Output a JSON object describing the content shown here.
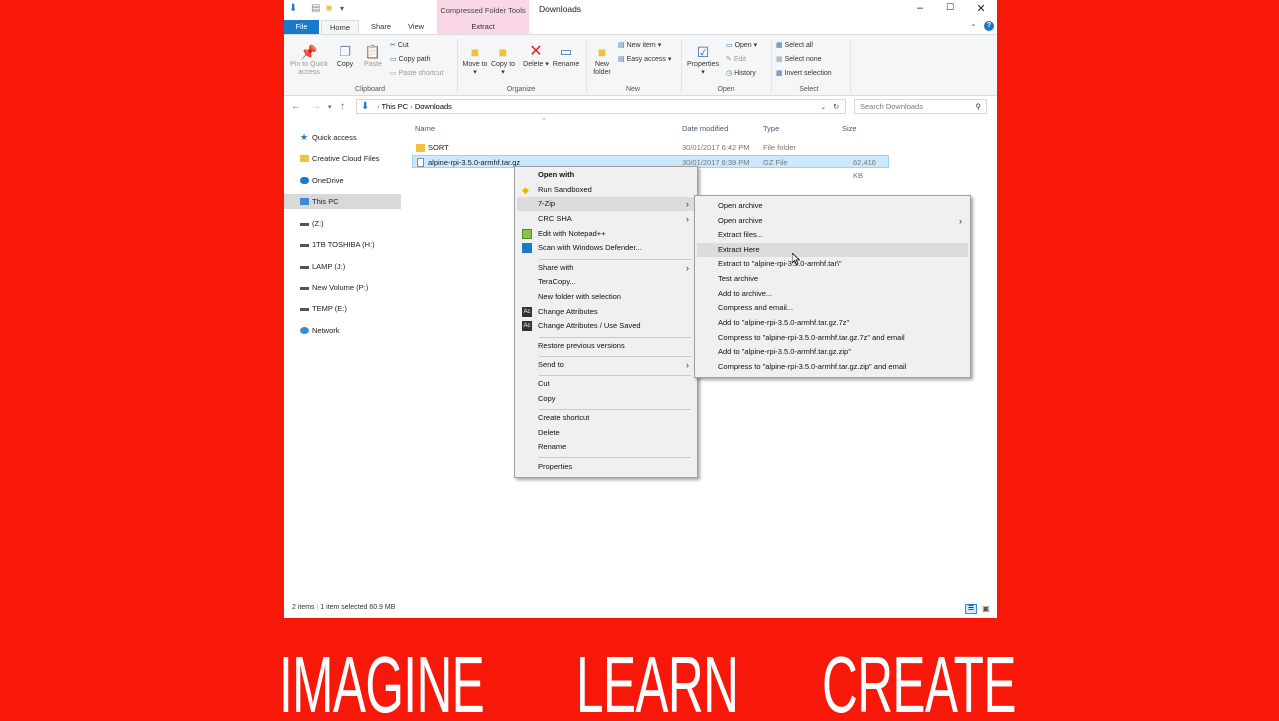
{
  "window": {
    "title": "Downloads",
    "context_tab": "Compressed Folder Tools",
    "context_subtab": "Extract",
    "tabs": [
      "File",
      "Home",
      "Share",
      "View"
    ]
  },
  "ribbon": {
    "clipboard": {
      "label": "Clipboard",
      "pin": "Pin to Quick access",
      "copy": "Copy",
      "paste": "Paste",
      "cut": "Cut",
      "copy_path": "Copy path",
      "paste_shortcut": "Paste shortcut"
    },
    "organize": {
      "label": "Organize",
      "move_to": "Move to",
      "copy_to": "Copy to",
      "delete": "Delete",
      "rename": "Rename"
    },
    "new": {
      "label": "New",
      "new_folder": "New folder",
      "new_item": "New item",
      "easy_access": "Easy access"
    },
    "open": {
      "label": "Open",
      "properties": "Properties",
      "open": "Open",
      "edit": "Edit",
      "history": "History"
    },
    "select": {
      "label": "Select",
      "select_all": "Select all",
      "select_none": "Select none",
      "invert": "Invert selection"
    }
  },
  "address": {
    "crumb1": "This PC",
    "crumb2": "Downloads",
    "search_placeholder": "Search Downloads"
  },
  "nav": [
    "Quick access",
    "Creative Cloud Files",
    "OneDrive",
    "This PC",
    "(Z:)",
    "1TB TOSHIBA (H:)",
    "LAMP (J:)",
    "New Volume (P:)",
    "TEMP (E:)",
    "Network"
  ],
  "columns": {
    "name": "Name",
    "date": "Date modified",
    "type": "Type",
    "size": "Size"
  },
  "files": [
    {
      "name": "SORT",
      "date": "30/01/2017 6:42 PM",
      "type": "File folder",
      "size": ""
    },
    {
      "name": "alpine-rpi-3.5.0-armhf.tar.gz",
      "date": "30/01/2017 6:39 PM",
      "type": "GZ File",
      "size": "62,416 KB"
    }
  ],
  "status": {
    "items": "2 items",
    "selected": "1 item selected  60.9 MB"
  },
  "context_menu": [
    "Open with",
    "Run Sandboxed",
    "7-Zip",
    "CRC SHA",
    "Edit with Notepad++",
    "Scan with Windows Defender...",
    "Share with",
    "TeraCopy...",
    "New folder with selection",
    "Change Attributes",
    "Change Attributes / Use Saved",
    "Restore previous versions",
    "Send to",
    "Cut",
    "Copy",
    "Create shortcut",
    "Delete",
    "Rename",
    "Properties"
  ],
  "submenu": [
    "Open archive",
    "Open archive",
    "Extract files...",
    "Extract Here",
    "Extract to \"alpine-rpi-3.5.0-armhf.tar\\\"",
    "Test archive",
    "Add to archive...",
    "Compress and email...",
    "Add to \"alpine-rpi-3.5.0-armhf.tar.gz.7z\"",
    "Compress to \"alpine-rpi-3.5.0-armhf.tar.gz.7z\" and email",
    "Add to \"alpine-rpi-3.5.0-armhf.tar.gz.zip\"",
    "Compress to \"alpine-rpi-3.5.0-armhf.tar.gz.zip\" and email"
  ],
  "banner": [
    "IMAGINE",
    "LEARN",
    "CREATE"
  ],
  "colors": {
    "background": "#f7180a",
    "accent": "#1979ca",
    "selection": "#cce8ff"
  }
}
